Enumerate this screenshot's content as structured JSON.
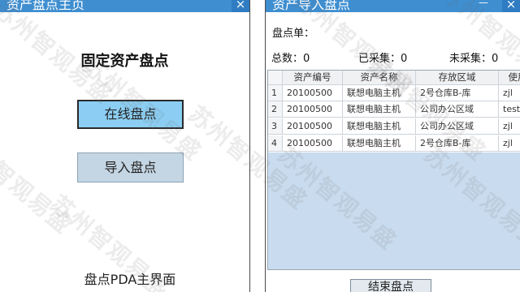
{
  "left_panel": {
    "title": "资产盘点主页",
    "heading": "固定资产盘点",
    "online_button": "在线盘点",
    "import_button": "导入盘点",
    "footer": "盘点PDA主界面"
  },
  "right_panel": {
    "title": "资产导入盘点",
    "order_label": "盘点单：",
    "total": "总数：0",
    "collected": "已采集：0",
    "uncollected": "未采集：0",
    "table": {
      "headers": [
        "资产编号",
        "资产名称",
        "存放区域",
        "使用"
      ],
      "rows": [
        {
          "no": "1",
          "code": "20100500",
          "name": "联想电脑主机",
          "area": "2号仓库B-库",
          "user": "zjl"
        },
        {
          "no": "2",
          "code": "20100500",
          "name": "联想电脑主机",
          "area": "公司办公区域",
          "user": "test"
        },
        {
          "no": "3",
          "code": "20100500",
          "name": "联想电脑主机",
          "area": "公司办公区域",
          "user": "zjl"
        },
        {
          "no": "4",
          "code": "20100500",
          "name": "联想电脑主机",
          "area": "2号仓库B-库",
          "user": "zjl"
        }
      ]
    },
    "end_button": "结束盘点"
  },
  "watermark": "苏州智观易盛",
  "icons": {
    "close": "close-icon",
    "minimize": "minimize-icon"
  },
  "colors": {
    "titlebar": "#3e8ed0",
    "online_button": "#8ccef3",
    "import_button": "#c4d5e3",
    "table_fill": "#c9dcef"
  }
}
